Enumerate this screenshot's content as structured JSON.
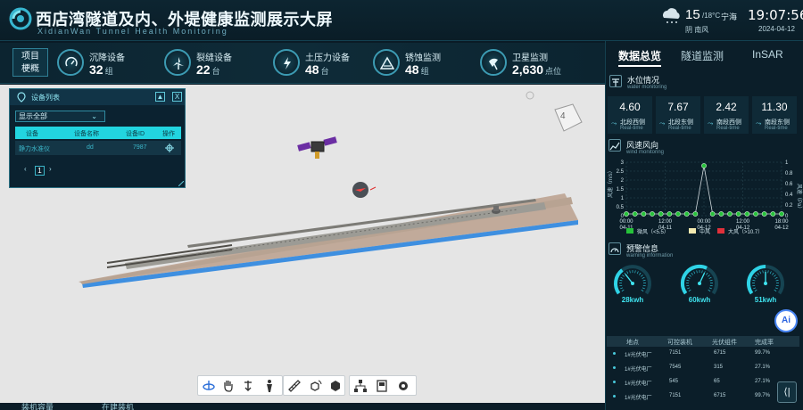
{
  "header": {
    "title": "西店湾隧道及内、外堤健康监测展示大屏",
    "subtitle": "XidianWan Tunnel Health Monitoring",
    "weather_icon": "cloud-snow-icon",
    "temperature": "15",
    "temp_range": "/18°C",
    "city": "宁海",
    "wind": "阴 南风",
    "time": "19:07:56",
    "date": "2024-04-12"
  },
  "project_tag": {
    "line1": "项目",
    "line2": "梗概"
  },
  "stats": [
    {
      "label": "沉降设备",
      "value": "32",
      "unit": "组",
      "icon": "gauge-icon"
    },
    {
      "label": "裂缝设备",
      "value": "22",
      "unit": "台",
      "icon": "windmill-icon"
    },
    {
      "label": "土压力设备",
      "value": "48",
      "unit": "台",
      "icon": "lightning-icon"
    },
    {
      "label": "锈蚀监测",
      "value": "48",
      "unit": "组",
      "icon": "warning-icon"
    },
    {
      "label": "卫星监测",
      "value": "2,630",
      "unit": "点位",
      "icon": "satellite-dish-icon"
    }
  ],
  "device_panel": {
    "title": "设备列表",
    "min_label": "▲",
    "close_label": "X",
    "select_value": "显示全部",
    "select_arrow": "⌄",
    "columns": [
      "设备",
      "设备名称",
      "设备ID",
      "操作"
    ],
    "row": {
      "device": "静力水准仪",
      "name": "dd",
      "id": "7987"
    },
    "page": "1",
    "prev": "‹",
    "next": "›"
  },
  "scene": {
    "compass_label": "4"
  },
  "toolbar": [
    "rotate-icon",
    "hand-icon",
    "move-down-icon",
    "person-icon",
    "ruler-icon",
    "cube-rotate-icon",
    "cube-icon",
    "network-icon",
    "device-icon",
    "settings-icon"
  ],
  "bottom_tabs": [
    "装机容量",
    "在建装机"
  ],
  "right_panel": {
    "tabs": [
      "数据总览",
      "隧道监测",
      "InSAR"
    ],
    "water": {
      "title": "水位情况",
      "subtitle": "water monitoring",
      "items": [
        {
          "value": "4.60",
          "name": "北段西侧",
          "note": "Real-time"
        },
        {
          "value": "7.67",
          "name": "北段东侧",
          "note": "Real-time"
        },
        {
          "value": "2.42",
          "name": "南段西侧",
          "note": "Real-time"
        },
        {
          "value": "11.30",
          "name": "南段东侧",
          "note": "Real-time"
        }
      ]
    },
    "wind": {
      "title": "风速风向",
      "subtitle": "wind monitoring",
      "left_axis_label": "风速（m/s）",
      "right_axis_label": "风速（Pa）",
      "legend": [
        {
          "label": "微风（<5.5）",
          "color": "#26c23a"
        },
        {
          "label": "中风",
          "color": "#f3eab0"
        },
        {
          "label": "大风（>10.7）",
          "color": "#e0303a"
        }
      ]
    },
    "warning": {
      "title": "预警信息",
      "subtitle": "warning information",
      "gauges": [
        {
          "value": "28kwh",
          "level": 0.35
        },
        {
          "value": "60kwh",
          "level": 0.6
        },
        {
          "value": "51kwh",
          "level": 0.5
        }
      ]
    },
    "table": {
      "headers": [
        "地点",
        "可控装机",
        "光伏组件",
        "完成率"
      ],
      "rows": [
        [
          "1#光伏电厂",
          "7151",
          "6715",
          "99.7%"
        ],
        [
          "1#光伏电厂",
          "7545",
          "315",
          "27.1%"
        ],
        [
          "1#光伏电厂",
          "545",
          "65",
          "27.1%"
        ],
        [
          "1#光伏电厂",
          "7151",
          "6715",
          "99.7%"
        ]
      ]
    },
    "ai_label": "Ai",
    "collapse_label": "⟨|"
  },
  "chart_data": {
    "type": "line",
    "title": "",
    "x": [
      "00:00 04-11",
      "12:00 04-11",
      "00:00 04-12",
      "12:00 04-12",
      "18:00 04-12"
    ],
    "left_ylim": [
      0,
      3
    ],
    "left_ticks": [
      "0",
      "0.5",
      "1",
      "1.5",
      "2",
      "2.5",
      "3"
    ],
    "right_ylim": [
      0,
      1
    ],
    "right_ticks": [
      "0",
      "0.2",
      "0.4",
      "0.6",
      "0.8",
      "1"
    ],
    "series": [
      {
        "values": [
          0.1,
          0.1,
          0.1,
          0.1,
          0.1,
          0.1,
          0.1,
          0.1,
          0.1,
          2.8,
          0.1,
          0.1,
          0.1,
          0.1,
          0.1,
          0.1,
          0.1,
          0.1,
          0.1
        ]
      }
    ],
    "grid": true
  }
}
